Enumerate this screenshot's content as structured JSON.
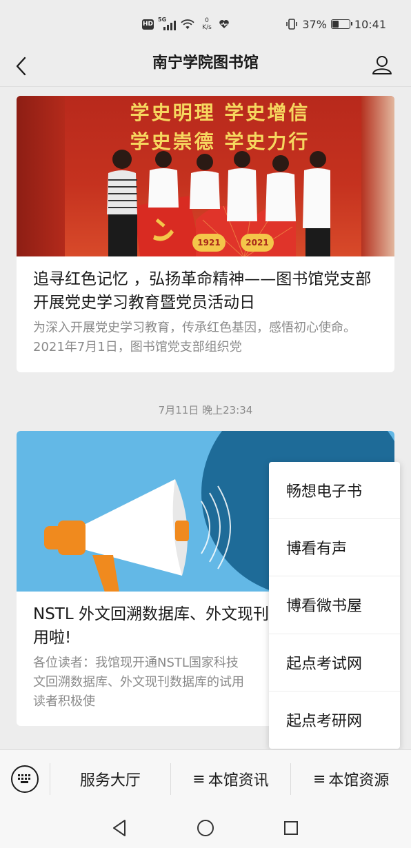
{
  "status_bar": {
    "hd": "HD",
    "signal": "5G",
    "net_speed_value": "0",
    "net_speed_unit": "K/s",
    "battery_percent": "37%",
    "battery_level": 0.37,
    "time": "10:41"
  },
  "nav": {
    "title": "南宁学院图书馆",
    "back_icon": "chevron-left-icon",
    "user_icon": "person-icon"
  },
  "articles": [
    {
      "image_banner_lines": [
        "学史明理 学史增信",
        "学史崇德 学史力行"
      ],
      "image_years": [
        "1921",
        "2021"
      ],
      "title": "追寻红色记忆 ，弘扬革命精神——图书馆党支部开展党史学习教育暨党员活动日",
      "digest": "为深入开展党史学习教育，传承红色基因，感悟初心使命。2021年7月1日，图书馆党支部组织党"
    },
    {
      "title": "NSTL 外文回溯数据库、外文现刊",
      "title_line2": "用啦!",
      "digest_lines": [
        "各位读者：我馆现开通NSTL国家科技",
        "文回溯数据库、外文现刊数据库的试用",
        "读者积极使"
      ]
    }
  ],
  "timestamp": "7月11日 晚上23:34",
  "popup_menu": {
    "items": [
      "畅想电子书",
      "博看有声",
      "博看微书屋",
      "起点考试网",
      "起点考研网"
    ]
  },
  "bottom_menu": {
    "keyboard_icon": "keyboard-icon",
    "menu_glyph": "≡",
    "tabs": [
      "服务大厅",
      "本馆资讯",
      "本馆资源"
    ]
  },
  "system_nav": {
    "back": "triangle-back-icon",
    "home": "circle-home-icon",
    "recents": "square-recents-icon"
  },
  "colors": {
    "background": "#ededed",
    "card": "#ffffff",
    "digest_text": "#8a8a8a",
    "poster_red": "#c5321f",
    "poster_gold": "#f6d75f",
    "poster_blue": "#63b8e6"
  }
}
